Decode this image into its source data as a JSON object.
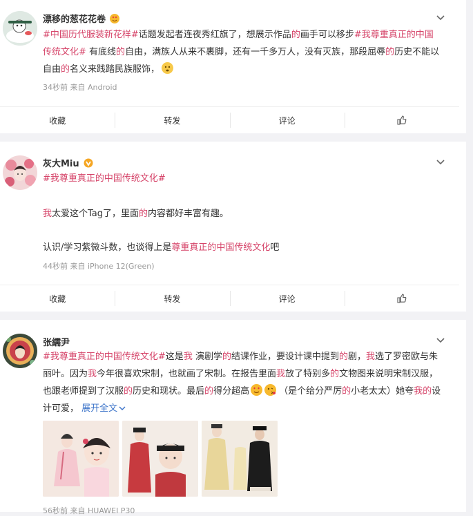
{
  "posts": [
    {
      "user": "漂移的葱花花卷",
      "text_runs": [
        {
          "t": "#中国历代服装新花样#",
          "hl": true
        },
        {
          "t": "话题发起者连夜秀红旗了，想展示作品",
          "hl": false
        },
        {
          "t": "的",
          "hl": true
        },
        {
          "t": "画手可以移步",
          "hl": false
        },
        {
          "t": "#我尊重真正的中国传统文化#",
          "hl": true
        },
        {
          "t": " 有底线",
          "hl": false
        },
        {
          "t": "的",
          "hl": true
        },
        {
          "t": "自由，满族人从来不裹脚，还有一千多万人，没有灭族，那段屈辱",
          "hl": false
        },
        {
          "t": "的",
          "hl": true
        },
        {
          "t": "历史不能以自由",
          "hl": false
        },
        {
          "t": "的",
          "hl": true
        },
        {
          "t": "名义来践踏民族服饰，",
          "hl": false
        }
      ],
      "meta": "34秒前  来自 Android"
    },
    {
      "user": "灰大Miu",
      "topic": "#我尊重真正的中国传统文化#",
      "para1_runs": [
        {
          "t": "我",
          "hl": true
        },
        {
          "t": "太爱这个Tag了，里面",
          "hl": false
        },
        {
          "t": "的",
          "hl": true
        },
        {
          "t": "内容都好丰富有趣。",
          "hl": false
        }
      ],
      "para2_runs": [
        {
          "t": "认识/学习紫微斗数，也谈得上是",
          "hl": false
        },
        {
          "t": "尊重真正的中国传统文化",
          "hl": true
        },
        {
          "t": "吧",
          "hl": false
        }
      ],
      "meta": "44秒前  来自 iPhone 12(Green)"
    },
    {
      "user": "张繻尹",
      "text_runs": [
        {
          "t": "#我尊重真正的中国传统文化#",
          "hl": true
        },
        {
          "t": "这是",
          "hl": false
        },
        {
          "t": "我",
          "hl": true
        },
        {
          "t": " 演剧学",
          "hl": false
        },
        {
          "t": "的",
          "hl": true
        },
        {
          "t": "结课作业，要设计课中提到",
          "hl": false
        },
        {
          "t": "的",
          "hl": true
        },
        {
          "t": "剧，",
          "hl": false
        },
        {
          "t": "我",
          "hl": true
        },
        {
          "t": "选了罗密欧与朱丽叶。因为",
          "hl": false
        },
        {
          "t": "我",
          "hl": true
        },
        {
          "t": "今年很喜欢宋制，也就画了宋制。在报告里面",
          "hl": false
        },
        {
          "t": "我",
          "hl": true
        },
        {
          "t": "放了特别多",
          "hl": false
        },
        {
          "t": "的",
          "hl": true
        },
        {
          "t": "文物图来说明宋制汉服，也跟老师提到了汉服",
          "hl": false
        },
        {
          "t": "的",
          "hl": true
        },
        {
          "t": "历史和现状。最后",
          "hl": false
        },
        {
          "t": "的",
          "hl": true
        },
        {
          "t": "得分超高",
          "hl": false
        }
      ],
      "text_tail_runs": [
        {
          "t": "（是个给分严厉",
          "hl": false
        },
        {
          "t": "的",
          "hl": true
        },
        {
          "t": "小老太太）她夸",
          "hl": false
        },
        {
          "t": "我的",
          "hl": true
        },
        {
          "t": "设计可爱，",
          "hl": false
        }
      ],
      "expand": "展开全文",
      "meta": "56秒前  来自 HUAWEI P30"
    }
  ],
  "actions": {
    "fav": "收藏",
    "repost": "转发",
    "comment": "评论"
  }
}
